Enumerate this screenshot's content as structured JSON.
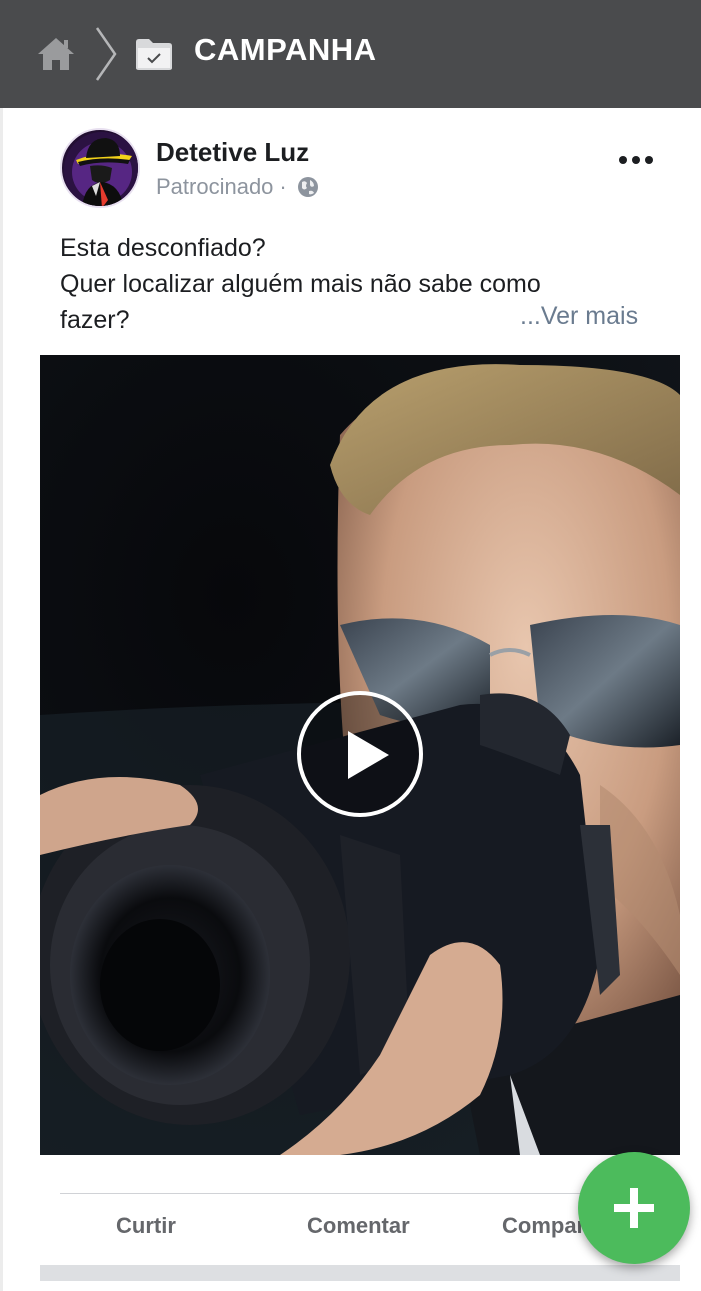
{
  "header": {
    "title": "CAMPANHA",
    "icons": [
      "home-icon",
      "chevron-right-icon",
      "folder-check-icon"
    ],
    "background": "#4a4b4d"
  },
  "post": {
    "author": "Detetive Luz",
    "sponsored": "Patrocinado",
    "separator": "·",
    "text_lines": [
      "Esta desconfiado?",
      "Quer localizar alguém mais não sabe como",
      "fazer?"
    ],
    "see_more": "...Ver mais",
    "media_icon": "play-icon"
  },
  "actions": {
    "like": "Curtir",
    "comment": "Comentar",
    "share": "Compar"
  },
  "fab": {
    "icon": "plus-icon",
    "color": "#4cbb5c"
  }
}
